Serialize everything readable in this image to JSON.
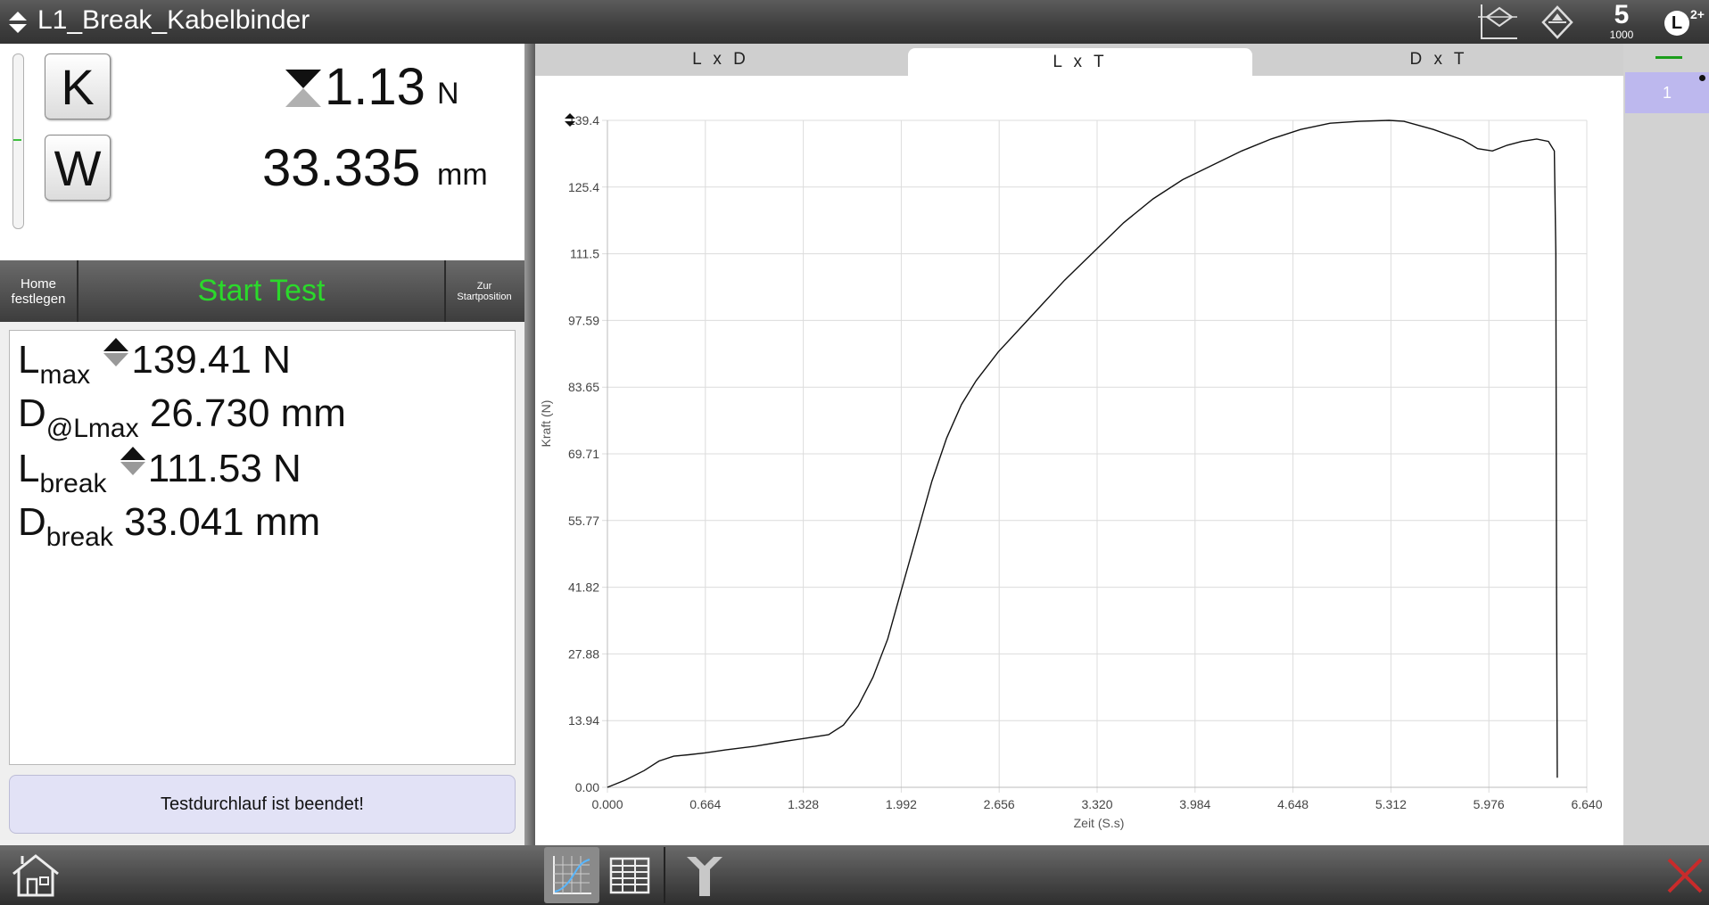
{
  "header": {
    "title": "L1_Break_Kabelbinder",
    "badge_s_sub": "1000",
    "badge_l_sup": "2+"
  },
  "readout": {
    "k_label": "K",
    "w_label": "W",
    "force_value": "1.13",
    "force_unit": "N",
    "distance_value": "33.335",
    "distance_unit": "mm"
  },
  "controls": {
    "home_label_1": "Home",
    "home_label_2": "festlegen",
    "start_label": "Start Test",
    "start_color": "#2bd92b",
    "zur_label_1": "Zur",
    "zur_label_2": "Startposition"
  },
  "results": {
    "lmax_main": "L",
    "lmax_sub": "max",
    "lmax_value": "139.41 N",
    "dlmax_main": "D",
    "dlmax_sub": "@Lmax",
    "dlmax_value": "26.730 mm",
    "lbreak_main": "L",
    "lbreak_sub": "break",
    "lbreak_value": "111.53 N",
    "dbreak_main": "D",
    "dbreak_sub": "break",
    "dbreak_value": "33.041 mm"
  },
  "status": {
    "message": "Testdurchlauf ist beendet!"
  },
  "tabs": [
    {
      "label": "L x D",
      "active": false
    },
    {
      "label": "L x T",
      "active": true
    },
    {
      "label": "D x T",
      "active": false
    }
  ],
  "side_panel": {
    "item_label": "1"
  },
  "chart_data": {
    "type": "line",
    "xlabel": "Zeit (S.s)",
    "ylabel": "Kraft (N)",
    "xlim": [
      0,
      6.64
    ],
    "ylim": [
      0,
      139.4
    ],
    "xticks": [
      "0.000",
      "0.664",
      "1.328",
      "1.992",
      "2.656",
      "3.320",
      "3.984",
      "4.648",
      "5.312",
      "5.976",
      "6.640"
    ],
    "yticks": [
      "0.00",
      "13.94",
      "27.88",
      "41.82",
      "55.77",
      "69.71",
      "83.65",
      "97.59",
      "111.5",
      "125.4",
      "139.4"
    ],
    "grid": true,
    "series": [
      {
        "color": "#111111",
        "x": [
          0,
          0.12,
          0.25,
          0.35,
          0.45,
          0.55,
          0.66,
          0.8,
          1.0,
          1.2,
          1.33,
          1.5,
          1.6,
          1.7,
          1.8,
          1.9,
          2.0,
          2.1,
          2.2,
          2.3,
          2.4,
          2.5,
          2.65,
          2.8,
          2.95,
          3.1,
          3.3,
          3.5,
          3.7,
          3.9,
          4.1,
          4.3,
          4.5,
          4.7,
          4.9,
          5.1,
          5.3,
          5.4,
          5.6,
          5.8,
          5.9,
          6.0,
          6.1,
          6.2,
          6.3,
          6.38,
          6.42,
          6.43,
          6.435,
          6.44
        ],
        "y": [
          0,
          1.5,
          3.5,
          5.5,
          6.5,
          6.8,
          7.2,
          7.8,
          8.6,
          9.6,
          10.2,
          11,
          13,
          17,
          23,
          31,
          42,
          53,
          64,
          73,
          80,
          85,
          91,
          96,
          101,
          106,
          112,
          118,
          123,
          127,
          130,
          133,
          135.5,
          137.5,
          138.8,
          139.2,
          139.4,
          139.2,
          137.5,
          135.3,
          133.5,
          133.0,
          134.2,
          135.0,
          135.5,
          135.0,
          133,
          111.5,
          40,
          2
        ]
      }
    ]
  }
}
